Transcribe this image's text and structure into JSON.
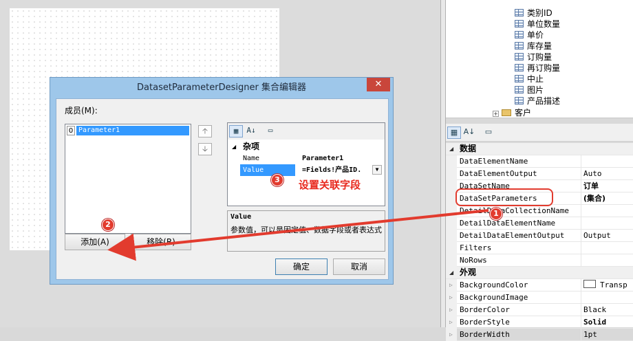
{
  "tree": {
    "fields": [
      "类别ID",
      "单位数量",
      "单价",
      "库存量",
      "订购量",
      "再订购量",
      "中止",
      "图片",
      "产品描述"
    ],
    "next_node": "客户"
  },
  "property_grid": {
    "toolbar_icons": [
      "categorized-icon",
      "alphabetical-icon",
      "property-pages-icon"
    ],
    "sections": [
      {
        "category": "数据",
        "rows": [
          {
            "name": "DataElementName",
            "value": ""
          },
          {
            "name": "DataElementOutput",
            "value": "Auto"
          },
          {
            "name": "DataSetName",
            "value": "订单"
          },
          {
            "name": "DataSetParameters",
            "value": "(集合)"
          },
          {
            "name": "DetailDataCollectionName",
            "value": ""
          },
          {
            "name": "DetailDataElementName",
            "value": ""
          },
          {
            "name": "DetailDataElementOutput",
            "value": "Output"
          },
          {
            "name": "Filters",
            "value": ""
          },
          {
            "name": "NoRows",
            "value": ""
          }
        ]
      },
      {
        "category": "外观",
        "rows": [
          {
            "name": "BackgroundColor",
            "value": "Transp"
          },
          {
            "name": "BackgroundImage",
            "value": ""
          },
          {
            "name": "BorderColor",
            "value": "Black"
          },
          {
            "name": "BorderStyle",
            "value": "Solid"
          },
          {
            "name": "BorderWidth",
            "value": "1pt"
          }
        ]
      }
    ]
  },
  "dialog": {
    "title": "DatasetParameterDesigner 集合编辑器",
    "close_glyph": "✕",
    "members_label": "成员(M):",
    "members": [
      {
        "index": "0",
        "name": "Parameter1"
      }
    ],
    "move_up_glyph": "🡡",
    "move_down_glyph": "🡣",
    "add_button": "添加(A)",
    "remove_button": "移除(R)",
    "ok_button": "确定",
    "cancel_button": "取消",
    "props": {
      "category": "杂项",
      "rows": [
        {
          "name": "Name",
          "value": "Parameter1"
        },
        {
          "name": "Value",
          "value": "=Fields!产品ID."
        }
      ]
    },
    "help": {
      "title": "Value",
      "text": "参数值，可以是固定值、数据字段或者表达式"
    }
  },
  "annotations": {
    "badge1": "1",
    "badge2": "2",
    "badge3": "3",
    "note": "设置关联字段",
    "color": "#e23b2e"
  }
}
